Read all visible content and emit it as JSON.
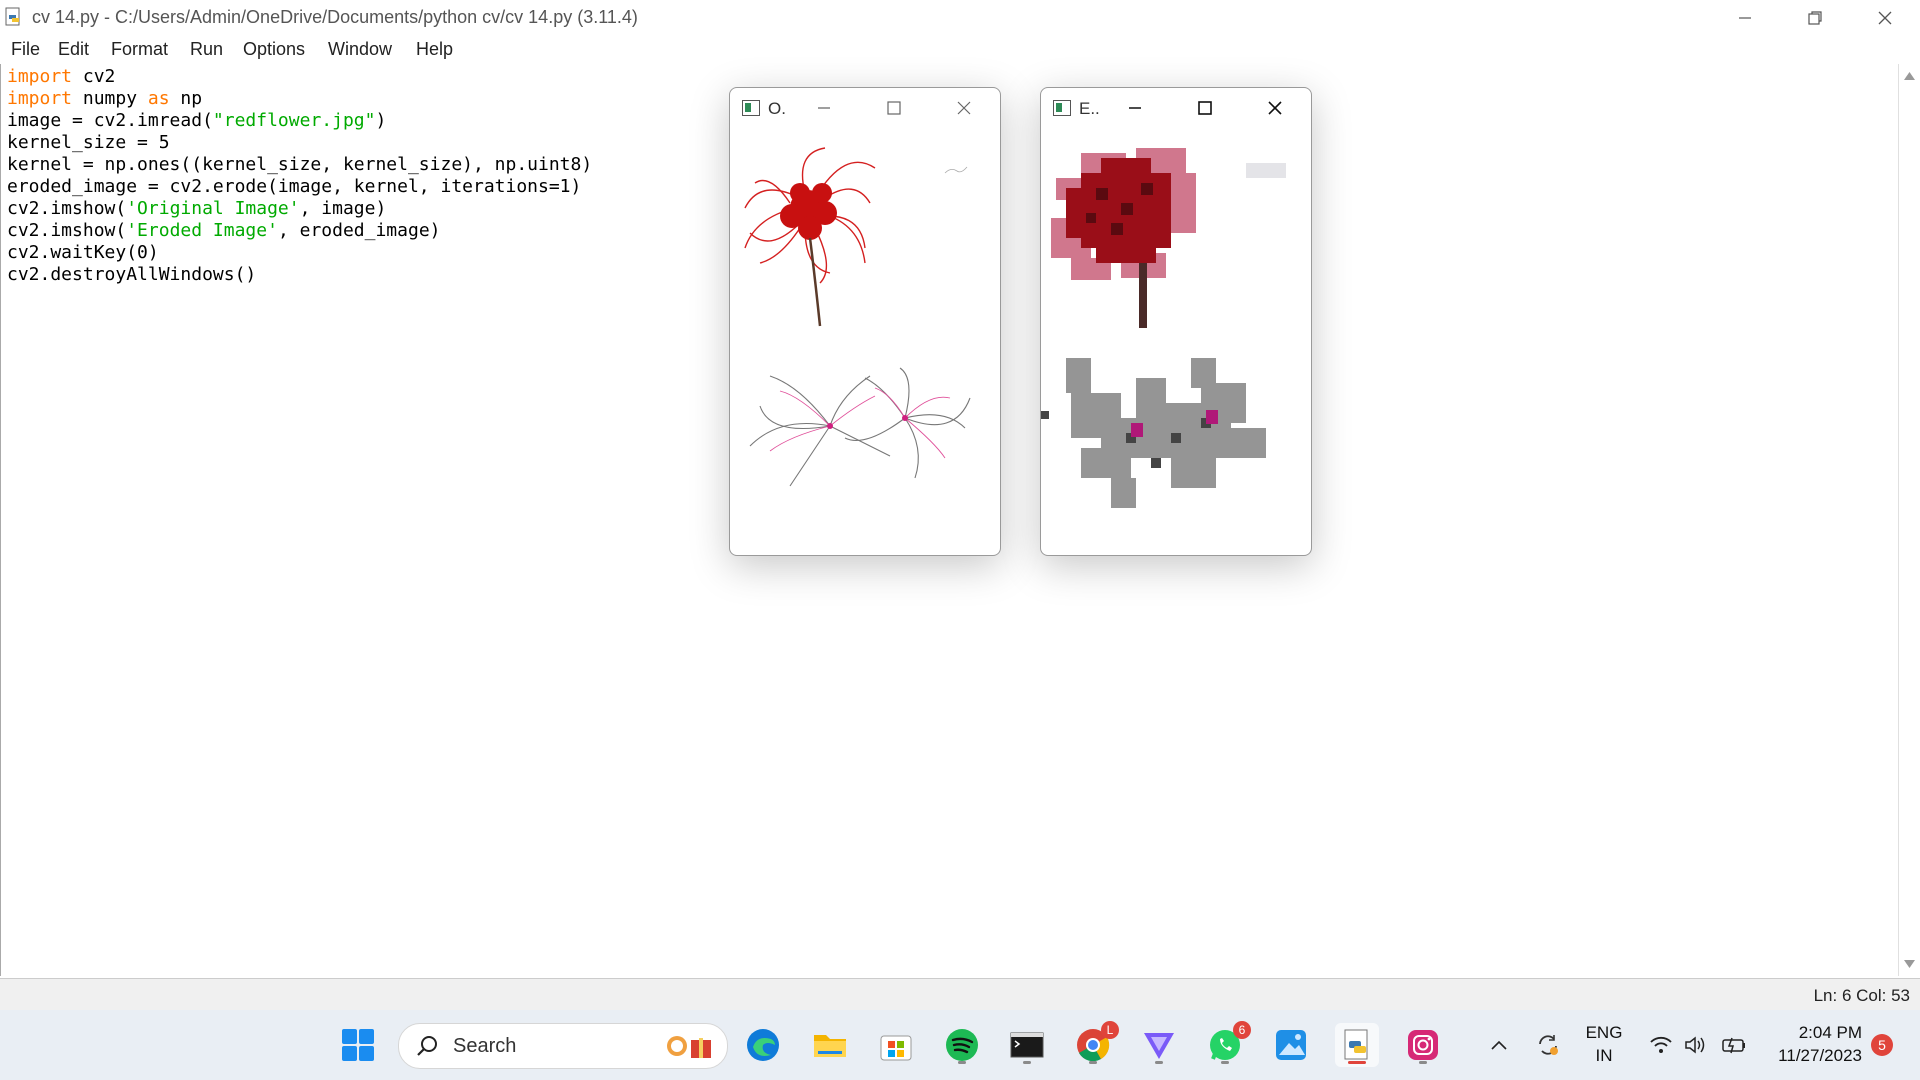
{
  "window": {
    "title": "cv 14.py - C:/Users/Admin/OneDrive/Documents/python cv/cv 14.py (3.11.4)"
  },
  "menu": [
    "File",
    "Edit",
    "Format",
    "Run",
    "Options",
    "Window",
    "Help"
  ],
  "code_lines": [
    [
      {
        "t": "import",
        "c": "kw"
      },
      {
        "t": " cv2"
      }
    ],
    [
      {
        "t": "import",
        "c": "kw"
      },
      {
        "t": " numpy "
      },
      {
        "t": "as",
        "c": "kw"
      },
      {
        "t": " np"
      }
    ],
    [
      {
        "t": "image = cv2.imread("
      },
      {
        "t": "\"redflower.jpg\"",
        "c": "str"
      },
      {
        "t": ")"
      }
    ],
    [
      {
        "t": "kernel_size = 5"
      }
    ],
    [
      {
        "t": "kernel = np.ones((kernel_size, kernel_size), np.uint8)"
      }
    ],
    [
      {
        "t": "eroded_image = cv2.erode(image, kernel, iterations=1)"
      }
    ],
    [
      {
        "t": "cv2.imshow("
      },
      {
        "t": "'Original Image'",
        "c": "str"
      },
      {
        "t": ", image)"
      }
    ],
    [
      {
        "t": "cv2.imshow("
      },
      {
        "t": "'Eroded Image'",
        "c": "str"
      },
      {
        "t": ", eroded_image)"
      }
    ],
    [
      {
        "t": "cv2.waitKey(0)"
      }
    ],
    [
      {
        "t": "cv2.destroyAllWindows()"
      }
    ]
  ],
  "status": {
    "position": "Ln: 6   Col: 53"
  },
  "windows": {
    "original": {
      "title": "O."
    },
    "eroded": {
      "title": "E.."
    }
  },
  "taskbar": {
    "search_label": "Search",
    "chrome_badge": "L",
    "whatsapp_badge": "6",
    "language": "ENG",
    "region": "IN",
    "time": "2:04 PM",
    "date": "11/27/2023",
    "notifications": "5"
  },
  "icons": [
    "python-idle-icon",
    "minimize-icon",
    "restore-icon",
    "close-icon",
    "windows-start-icon",
    "search-icon",
    "edge-icon",
    "file-explorer-icon",
    "microsoft-store-icon",
    "spotify-icon",
    "terminal-icon",
    "chrome-icon",
    "vpn-icon",
    "whatsapp-icon",
    "photos-icon",
    "python-icon",
    "instagram-icon",
    "chevron-up-icon",
    "sync-icon",
    "wifi-icon",
    "volume-icon",
    "battery-icon"
  ]
}
